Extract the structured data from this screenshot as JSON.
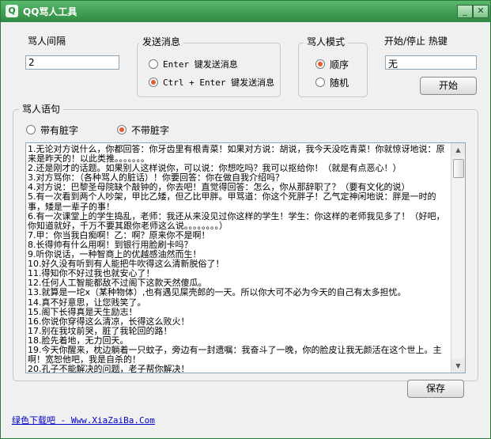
{
  "window": {
    "title": "QQ骂人工具",
    "icon": "app-icon",
    "minimize_icon": "_",
    "close_icon": "✕"
  },
  "interval": {
    "label": "骂人间隔",
    "value": "2"
  },
  "send_message": {
    "label": "发送消息",
    "options": [
      "Enter 键发送消息",
      "Ctrl + Enter 键发送消息"
    ],
    "selected": 1
  },
  "mode": {
    "label": "骂人模式",
    "options": [
      "顺序",
      "随机"
    ],
    "selected": 0
  },
  "hotkey": {
    "label": "开始/停止 热键",
    "value": "无",
    "start_button": "开始"
  },
  "phrases": {
    "label": "骂人语句",
    "options": [
      "带有脏字",
      "不带脏字"
    ],
    "selected": 1,
    "lines": [
      "1.无论对方说什么，你都回答：你牙齿里有根青菜！如果对方说：胡说，我今天没吃青菜！你就惊讶地说：原来是昨天的！以此类推。。。。。。。",
      "2.还是刚才的话题。如果别人这样说你，可以说：你想吃吗？我可以抠给你！（就是有点恶心！）",
      "3.对方骂你：（各种骂人的脏话）！你要回答：你在做自我介绍吗？",
      "4.对方说：巴黎圣母院缺个敲钟的，你去吧！直觉得回答：怎么，你从那辞职了？（要有文化的说）",
      "5.有一次看到两个人吵架，甲比乙矮，但乙比甲胖。甲骂道：你这个死胖子！乙气定神闲地说：胖是一时的事，矮是一辈子的事！",
      "6.有一次课堂上的学生捣乱，老师：我还从来没见过你这样的学生！学生：你这样的老师我见多了！（好吧，你知道就好，千万不要其跟你老师这么说。。。。。。。。）",
      "7.甲：你当我白痴啊！乙：啊？原来你不是啊！",
      "8.长得帅有什么用啊！到银行用脸刷卡吗？",
      "9.听你说话，一种智商上的优越感油然而生！",
      "10.好久没有听到有人能把牛吹得这么清新脱俗了！",
      "11.得知你不好过我也就安心了！",
      "12.任何人工智能都敌不过阁下这款天然傻瓜。",
      "13.就算是一坨x（某种物体）,也有遇见屎壳郎的一天。所以你大可不必为今天的自己有太多担忧。",
      "14.真不好意思，让您贱笑了。",
      "15.阁下长得真是天生励志！",
      "16.你说你穿得这么清凉，长得这么败火！",
      "17.别在我坟前哭，脏了我轮回的路！",
      "18.脸先着地，无力回天。",
      "19.今天你醒来，枕边躺着一只蚊子，旁边有一封遗嘱：我奋斗了一晚，你的脸皮让我无颜活在这个世上。主啊！宽恕他吧，我是自杀的！",
      "20.孔子不能解决的问题，老子帮你解决！"
    ]
  },
  "save_button": "保存",
  "footer_link": "绿色下载吧 - Www.XiaZaiBa.Com"
}
